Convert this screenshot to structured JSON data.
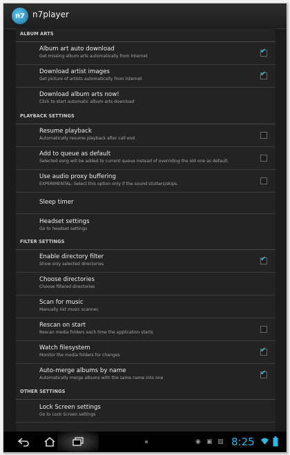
{
  "app": {
    "title": "n7player"
  },
  "sections": [
    {
      "header": "ALBUM ARTS",
      "items": [
        {
          "title": "Album art auto download",
          "summary": "Get missing album arts automatically from Internet",
          "checkbox": true,
          "checked": true
        },
        {
          "title": "Download artist images",
          "summary": "Get picture of artists automatically from Internet",
          "checkbox": true,
          "checked": true
        },
        {
          "title": "Download album arts now!",
          "summary": "Click to start automatic album arts download",
          "checkbox": false,
          "checked": false
        }
      ]
    },
    {
      "header": "PLAYBACK SETTINGS",
      "items": [
        {
          "title": "Resume playback",
          "summary": "Automatically resume playback after call end",
          "checkbox": true,
          "checked": false
        },
        {
          "title": "Add to queue as default",
          "summary": "Selected song will be added to current queue instead of overriding the old one as default.",
          "checkbox": true,
          "checked": false
        },
        {
          "title": "Use audio proxy buffering",
          "summary": "EXPERIMENTAL: Select this option only if the sound stutters/skips.",
          "checkbox": true,
          "checked": false
        },
        {
          "title": "Sleep timer",
          "summary": "",
          "checkbox": false,
          "checked": false
        },
        {
          "title": "Headset settings",
          "summary": "Go to headset settings",
          "checkbox": false,
          "checked": false
        }
      ]
    },
    {
      "header": "FILTER SETTINGS",
      "items": [
        {
          "title": "Enable directory filter",
          "summary": "Show only selected directories",
          "checkbox": true,
          "checked": true
        },
        {
          "title": "Choose directories",
          "summary": "Choose filtered directories",
          "checkbox": false,
          "checked": false
        },
        {
          "title": "Scan for music",
          "summary": "Manually init music scanner.",
          "checkbox": false,
          "checked": false
        },
        {
          "title": "Rescan on start",
          "summary": "Rescan media folders each time the application starts",
          "checkbox": true,
          "checked": false
        },
        {
          "title": "Watch filesystem",
          "summary": "Monitor the media folders for changes",
          "checkbox": true,
          "checked": true
        },
        {
          "title": "Auto-merge albums by name",
          "summary": "Automatically merge albums with the same name into one",
          "checkbox": true,
          "checked": true
        }
      ]
    },
    {
      "header": "OTHER SETTINGS",
      "items": [
        {
          "title": "Lock Screen settings",
          "summary": "Go to Lock Screen settings",
          "checkbox": false,
          "checked": false
        }
      ]
    }
  ],
  "statusbar": {
    "time": "8:25"
  },
  "colors": {
    "accent": "#33b5e5",
    "background": "#232323",
    "navbar": "#000000"
  },
  "icons": {
    "back": "back-arrow-icon",
    "home": "home-icon",
    "recent": "recent-apps-icon",
    "wifi": "wifi-icon",
    "battery": "battery-icon"
  }
}
